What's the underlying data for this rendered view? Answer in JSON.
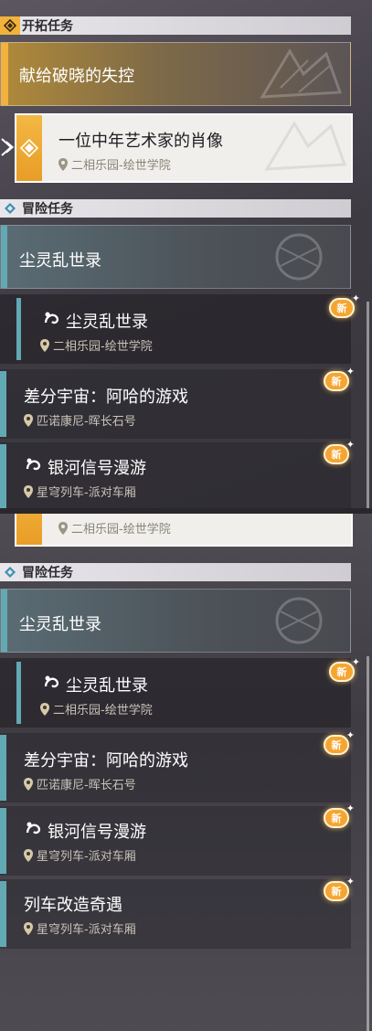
{
  "top": {
    "pioneer_header": "开拓任务",
    "featured_task": "献给破晓的失控",
    "selected_task": {
      "title": "一位中年艺术家的肖像",
      "location": "二相乐园-绘世学院"
    },
    "adventure_header": "冒险任务",
    "group_title": "尘灵乱世录",
    "items": [
      {
        "title": "尘灵乱世录",
        "location": "二相乐园-绘世学院",
        "badge": "新"
      },
      {
        "title": "差分宇宙：阿哈的游戏",
        "location": "匹诺康尼-晖长石号",
        "badge": "新"
      },
      {
        "title": "银河信号漫游",
        "location": "星穹列车-派对车厢",
        "badge": "新"
      }
    ]
  },
  "bottom": {
    "partial_location": "二相乐园-绘世学院",
    "adventure_header": "冒险任务",
    "group_title": "尘灵乱世录",
    "items": [
      {
        "title": "尘灵乱世录",
        "location": "二相乐园-绘世学院",
        "badge": "新"
      },
      {
        "title": "差分宇宙：阿哈的游戏",
        "location": "匹诺康尼-晖长石号",
        "badge": "新"
      },
      {
        "title": "银河信号漫游",
        "location": "星穹列车-派对车厢",
        "badge": "新"
      },
      {
        "title": "列车改造奇遇",
        "location": "星穹列车-派对车厢",
        "badge": "新"
      }
    ]
  },
  "colors": {
    "accent_gold": "#f2b23c",
    "accent_teal": "#62a9b4",
    "badge_orange": "#f6a531"
  },
  "icons": [
    "pioneer-diamond-icon",
    "adventure-diamond-icon",
    "selected-arrow-icon",
    "location-pin-icon",
    "event-swirl-icon",
    "new-badge-icon"
  ]
}
